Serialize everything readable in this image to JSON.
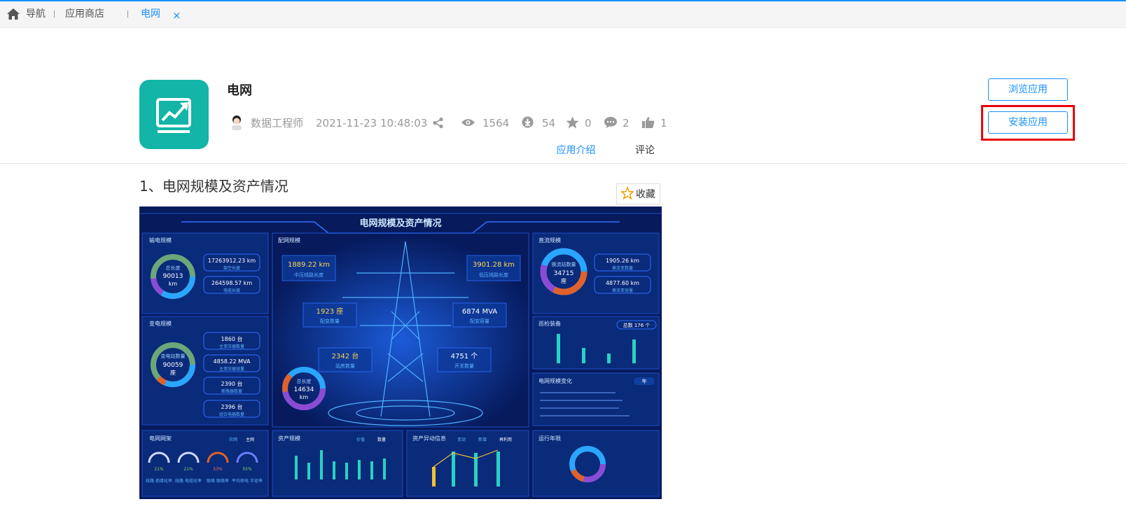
{
  "nav": {
    "tabs": [
      {
        "label": "导航"
      },
      {
        "label": "应用商店"
      },
      {
        "label": "电网",
        "close": "×"
      }
    ]
  },
  "app": {
    "title": "电网",
    "author": "数据工程师",
    "datetime": "2021-11-23 10:48:03",
    "views": "1564",
    "downloads": "54",
    "stars": "0",
    "comments": "2",
    "likes": "1"
  },
  "actions": {
    "browse": "浏览应用",
    "install": "安装应用"
  },
  "subtabs": [
    {
      "label": "应用介绍"
    },
    {
      "label": "评论"
    }
  ],
  "content": {
    "section_title": "1、电网规模及资产情况",
    "favorite_label": "收藏"
  },
  "dashboard": {
    "title": "电网规模及资产情况",
    "panels": {
      "transmission": "输电规模",
      "distribution": "配网规模",
      "dc": "直流规模",
      "substation": "变电规模",
      "equipment": "巡检装备",
      "change": "电网规模变化",
      "grid_rate": "电网网架",
      "asset": "资产规模",
      "asset_info": "资产异动信息",
      "age": "运行年限"
    },
    "ring1": {
      "label": "总长度",
      "value": "90013",
      "unit": "km"
    },
    "ring2": {
      "label": "变电站数量",
      "value": "90059",
      "unit": "座"
    },
    "ring3": {
      "label": "换流站数量",
      "value": "34715",
      "unit": "座"
    },
    "ring4": {
      "label": "总长度",
      "value": "14634",
      "unit": "km"
    },
    "boxes_left": [
      {
        "value": "17263912.23 km",
        "label": "架空长度"
      },
      {
        "value": "264598.57 km",
        "label": "电缆长度"
      },
      {
        "value": "1860 台",
        "label": "主变压器数量"
      },
      {
        "value": "4858.22 MVA",
        "label": "主变压器容量"
      },
      {
        "value": "2390 台",
        "label": "断路器数量"
      },
      {
        "value": "2396 台",
        "label": "组合电器数量"
      }
    ],
    "boxes_center": [
      {
        "value": "1889.22 km",
        "label": "中压线路长度"
      },
      {
        "value": "3901.28 km",
        "label": "低压线路长度"
      },
      {
        "value": "1923 座",
        "label": "配变数量"
      },
      {
        "value": "6874 MVA",
        "label": "配变容量"
      },
      {
        "value": "2342 台",
        "label": "站房数量"
      },
      {
        "value": "4751 个",
        "label": "开关数量"
      }
    ],
    "boxes_right": [
      {
        "value": "1905.26 km",
        "label": "换流变数量"
      },
      {
        "value": "4877.60 km",
        "label": "换流变容量"
      }
    ],
    "equip_total": "总数 176 个",
    "year_tag": "年",
    "tabs_grid": [
      "农网",
      "主网"
    ],
    "tabs_asset": [
      "价值",
      "数量"
    ],
    "tabs_info": [
      "变动",
      "新增",
      "再利用"
    ],
    "gauges": [
      {
        "pct": "21%",
        "label": "线路 绝缘化率"
      },
      {
        "pct": "21%",
        "label": "线路 电缆化率"
      },
      {
        "pct": "53%",
        "label": "联络 联络率"
      },
      {
        "pct": "55%",
        "label": "平均供电 半径率"
      }
    ]
  },
  "colors": {
    "accent": "#1890ff",
    "app_icon_bg": "#12b5a7",
    "highlight_border": "#e8000b",
    "dashboard_bg": "#061a5c"
  }
}
